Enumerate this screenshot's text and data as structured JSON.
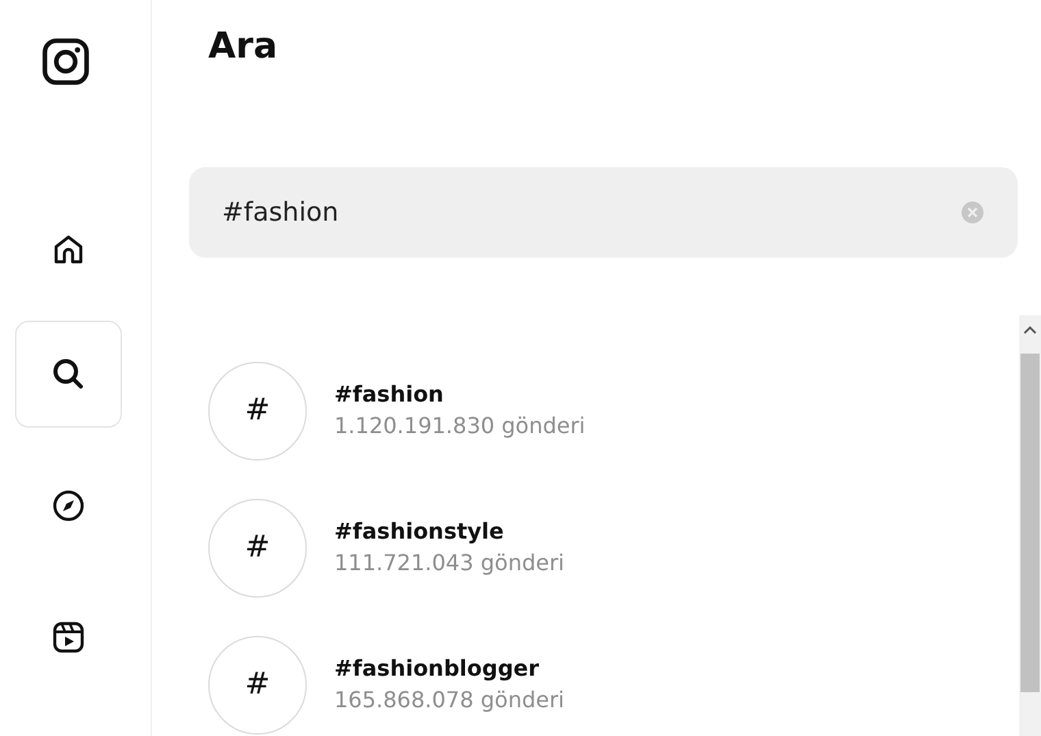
{
  "sidebar": {
    "items": [
      {
        "kind": "home",
        "selected": false
      },
      {
        "kind": "search",
        "selected": true
      },
      {
        "kind": "explore",
        "selected": false
      },
      {
        "kind": "reels",
        "selected": false
      }
    ]
  },
  "title": "Ara",
  "search": {
    "value": "#fashion"
  },
  "results": [
    {
      "glyph": "#",
      "name": "#fashion",
      "count": "1.120.191.830 gönderi"
    },
    {
      "glyph": "#",
      "name": "#fashionstyle",
      "count": "111.721.043 gönderi"
    },
    {
      "glyph": "#",
      "name": "#fashionblogger",
      "count": "165.868.078 gönderi"
    }
  ]
}
